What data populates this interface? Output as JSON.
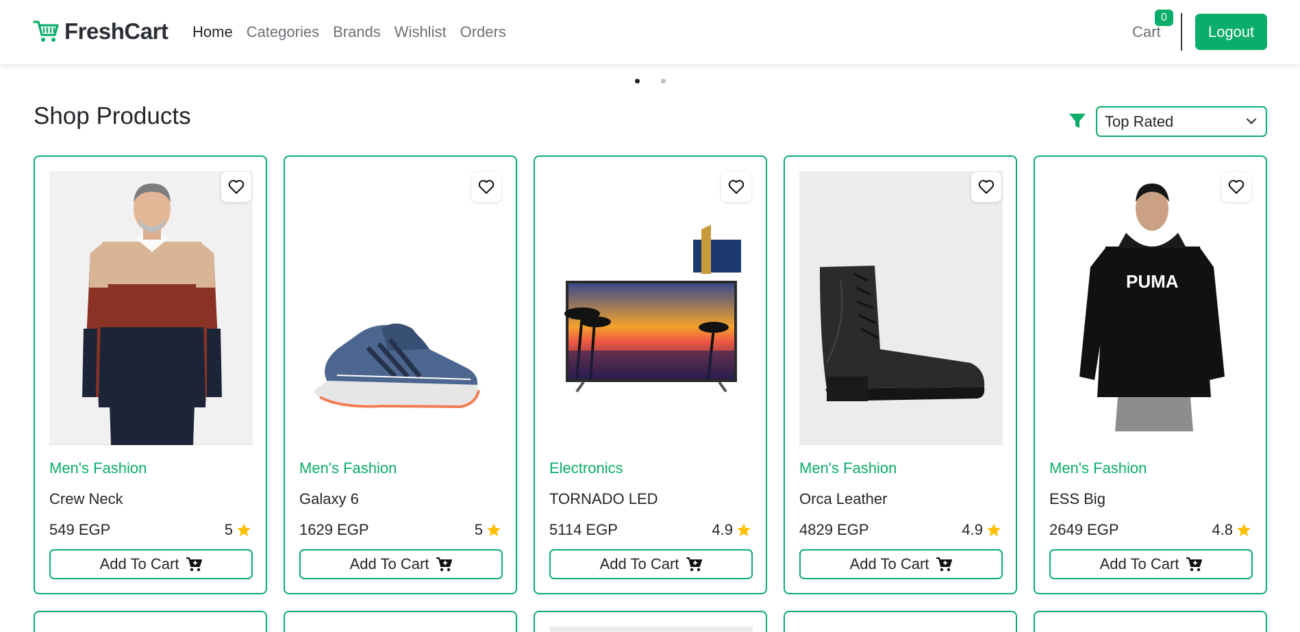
{
  "brand": {
    "name": "FreshCart",
    "logo_icon": "shopping-cart-icon",
    "color": "#0aad6a"
  },
  "nav": {
    "links": [
      {
        "label": "Home",
        "active": true
      },
      {
        "label": "Categories",
        "active": false
      },
      {
        "label": "Brands",
        "active": false
      },
      {
        "label": "Wishlist",
        "active": false
      },
      {
        "label": "Orders",
        "active": false
      }
    ],
    "cart_label": "Cart",
    "cart_count": "0",
    "logout_label": "Logout"
  },
  "slider": {
    "dots": 2,
    "active_index": 0
  },
  "main": {
    "title": "Shop Products",
    "sort": {
      "selected": "Top Rated",
      "icon": "filter-icon"
    }
  },
  "products": [
    {
      "category": "Men's Fashion",
      "name": "Crew Neck",
      "price": "549 EGP",
      "rating": "5",
      "add_label": "Add To Cart",
      "image": "sweater"
    },
    {
      "category": "Men's Fashion",
      "name": "Galaxy 6",
      "price": "1629 EGP",
      "rating": "5",
      "add_label": "Add To Cart",
      "image": "shoe"
    },
    {
      "category": "Electronics",
      "name": "TORNADO LED",
      "price": "5114 EGP",
      "rating": "4.9",
      "add_label": "Add To Cart",
      "image": "tv"
    },
    {
      "category": "Men's Fashion",
      "name": "Orca Leather",
      "price": "4829 EGP",
      "rating": "4.9",
      "add_label": "Add To Cart",
      "image": "boot"
    },
    {
      "category": "Men's Fashion",
      "name": "ESS Big",
      "price": "2649 EGP",
      "rating": "4.8",
      "add_label": "Add To Cart",
      "image": "hoodie"
    }
  ],
  "colors": {
    "accent": "#0aad6a",
    "star": "#ffc107",
    "text": "#212529",
    "muted": "#6b7077"
  }
}
